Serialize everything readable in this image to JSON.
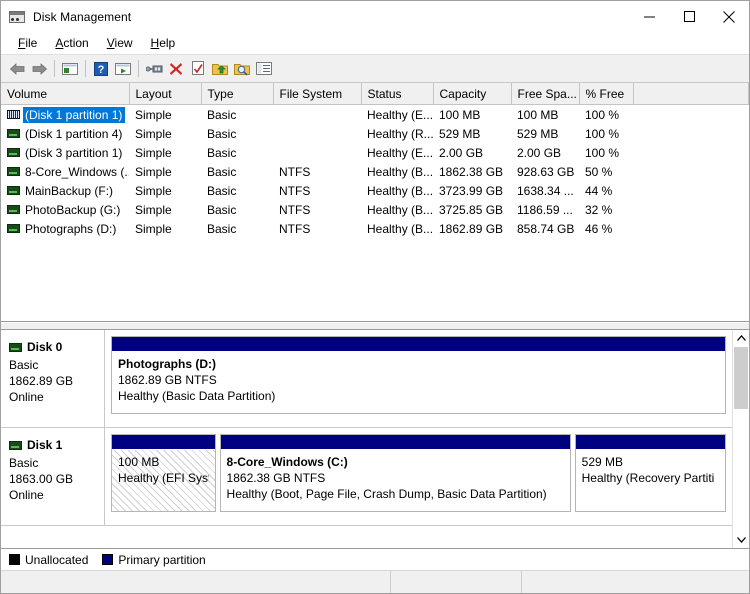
{
  "window": {
    "title": "Disk Management",
    "icon": "disk-management-icon",
    "controls": {
      "minimize": "minimize-icon",
      "maximize": "maximize-icon",
      "close": "close-icon"
    }
  },
  "menubar": {
    "items": [
      {
        "label": "File",
        "accel": "F"
      },
      {
        "label": "Action",
        "accel": "A"
      },
      {
        "label": "View",
        "accel": "V"
      },
      {
        "label": "Help",
        "accel": "H"
      }
    ]
  },
  "toolbar": {
    "buttons": [
      "back-arrow-icon",
      "forward-arrow-icon",
      "show-hide-tree-icon",
      "help-icon",
      "properties-window-icon",
      "connect-icon",
      "delete-icon",
      "checked-document-icon",
      "folder-up-icon",
      "folder-search-icon",
      "detail-list-icon"
    ]
  },
  "volume_list": {
    "columns": [
      "Volume",
      "Layout",
      "Type",
      "File System",
      "Status",
      "Capacity",
      "Free Spa...",
      "% Free",
      ""
    ],
    "selected_row": 0,
    "rows": [
      {
        "volume": "(Disk 1 partition 1)",
        "layout": "Simple",
        "type": "Basic",
        "filesystem": "",
        "status": "Healthy (E...",
        "capacity": "100 MB",
        "free_space": "100 MB",
        "percent_free": "100 %"
      },
      {
        "volume": "(Disk 1 partition 4)",
        "layout": "Simple",
        "type": "Basic",
        "filesystem": "",
        "status": "Healthy (R...",
        "capacity": "529 MB",
        "free_space": "529 MB",
        "percent_free": "100 %"
      },
      {
        "volume": "(Disk 3 partition 1)",
        "layout": "Simple",
        "type": "Basic",
        "filesystem": "",
        "status": "Healthy (E...",
        "capacity": "2.00 GB",
        "free_space": "2.00 GB",
        "percent_free": "100 %"
      },
      {
        "volume": "8-Core_Windows (...",
        "layout": "Simple",
        "type": "Basic",
        "filesystem": "NTFS",
        "status": "Healthy (B...",
        "capacity": "1862.38 GB",
        "free_space": "928.63 GB",
        "percent_free": "50 %"
      },
      {
        "volume": "MainBackup (F:)",
        "layout": "Simple",
        "type": "Basic",
        "filesystem": "NTFS",
        "status": "Healthy (B...",
        "capacity": "3723.99 GB",
        "free_space": "1638.34 ...",
        "percent_free": "44 %"
      },
      {
        "volume": "PhotoBackup (G:)",
        "layout": "Simple",
        "type": "Basic",
        "filesystem": "NTFS",
        "status": "Healthy (B...",
        "capacity": "3725.85 GB",
        "free_space": "1186.59 ...",
        "percent_free": "32 %"
      },
      {
        "volume": "Photographs (D:)",
        "layout": "Simple",
        "type": "Basic",
        "filesystem": "NTFS",
        "status": "Healthy (B...",
        "capacity": "1862.89 GB",
        "free_space": "858.74 GB",
        "percent_free": "46 %"
      }
    ]
  },
  "disks": [
    {
      "name": "Disk 0",
      "type": "Basic",
      "size": "1862.89 GB",
      "state": "Online",
      "partitions": [
        {
          "title": "Photographs  (D:)",
          "size_fs": "1862.89 GB NTFS",
          "health": "Healthy (Basic Data Partition)",
          "style": "primary",
          "width_pct": 100
        }
      ]
    },
    {
      "name": "Disk 1",
      "type": "Basic",
      "size": "1863.00 GB",
      "state": "Online",
      "partitions": [
        {
          "title": "",
          "size_fs": "100 MB",
          "health": "Healthy (EFI Syste",
          "style": "efi",
          "width_pct": 17
        },
        {
          "title": "8-Core_Windows  (C:)",
          "size_fs": "1862.38 GB NTFS",
          "health": "Healthy (Boot, Page File, Crash Dump, Basic Data Partition)",
          "style": "primary",
          "width_pct": 58
        },
        {
          "title": "",
          "size_fs": "529 MB",
          "health": "Healthy (Recovery Partiti",
          "style": "primary",
          "width_pct": 25
        }
      ]
    }
  ],
  "legend": {
    "items": [
      {
        "label": "Unallocated",
        "color": "#000000"
      },
      {
        "label": "Primary partition",
        "color": "#000080"
      }
    ]
  },
  "colors": {
    "selection": "#0078d7",
    "partition_bar": "#000080",
    "unallocated": "#000000"
  },
  "statusbar": {
    "panes": [
      "",
      "",
      ""
    ]
  }
}
